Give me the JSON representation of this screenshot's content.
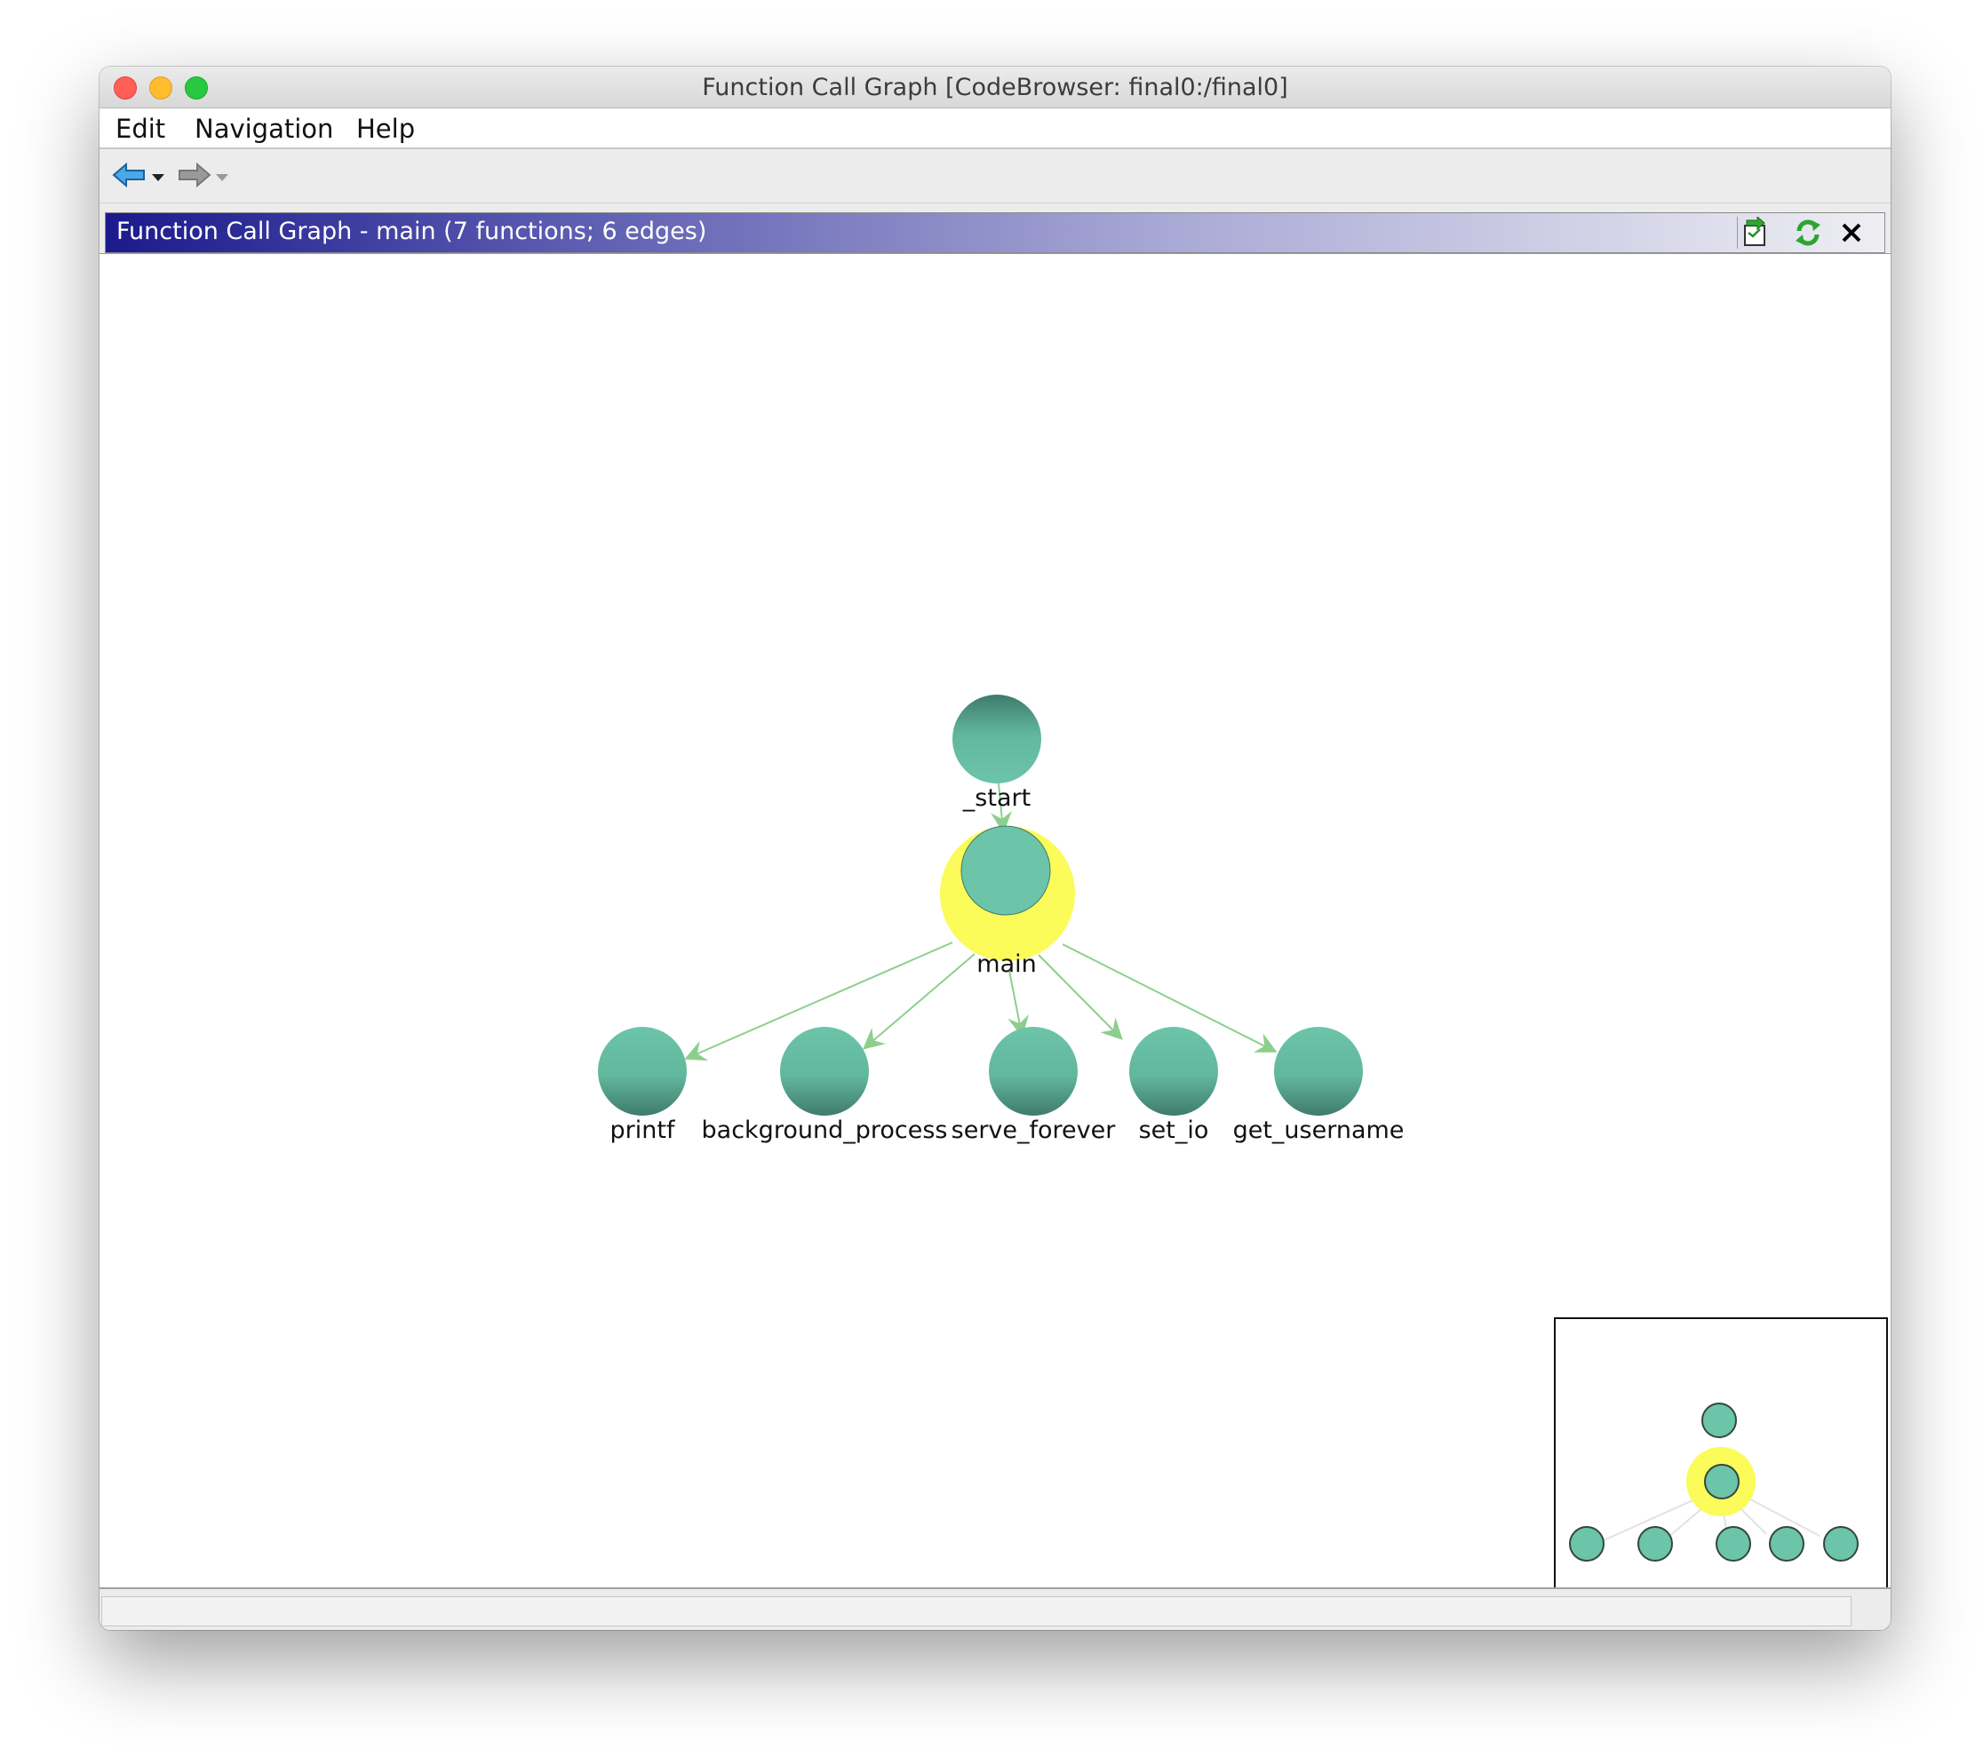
{
  "window": {
    "title": "Function Call Graph [CodeBrowser: final0:/final0]"
  },
  "menu": {
    "items": [
      "Edit",
      "Navigation",
      "Help"
    ]
  },
  "toolbar": {
    "back_icon": "back-arrow-icon",
    "forward_icon": "forward-arrow-icon"
  },
  "panel": {
    "title": "Function Call Graph - main (7 functions; 6 edges)",
    "buttons": [
      "snapshot-icon",
      "refresh-icon",
      "close-icon"
    ]
  },
  "graph": {
    "focus": "main",
    "nodes": [
      "_start",
      "main",
      "printf",
      "background_process",
      "serve_forever",
      "set_io",
      "get_username"
    ],
    "edges": [
      [
        "_start",
        "main"
      ],
      [
        "main",
        "printf"
      ],
      [
        "main",
        "background_process"
      ],
      [
        "main",
        "serve_forever"
      ],
      [
        "main",
        "set_io"
      ],
      [
        "main",
        "get_username"
      ]
    ],
    "colors": {
      "node": "#6cc4a9",
      "node_dark": "#3f7b6b",
      "highlight": "#fbfb5a",
      "edge": "#8ccf8c"
    }
  },
  "status": {
    "text": ""
  }
}
